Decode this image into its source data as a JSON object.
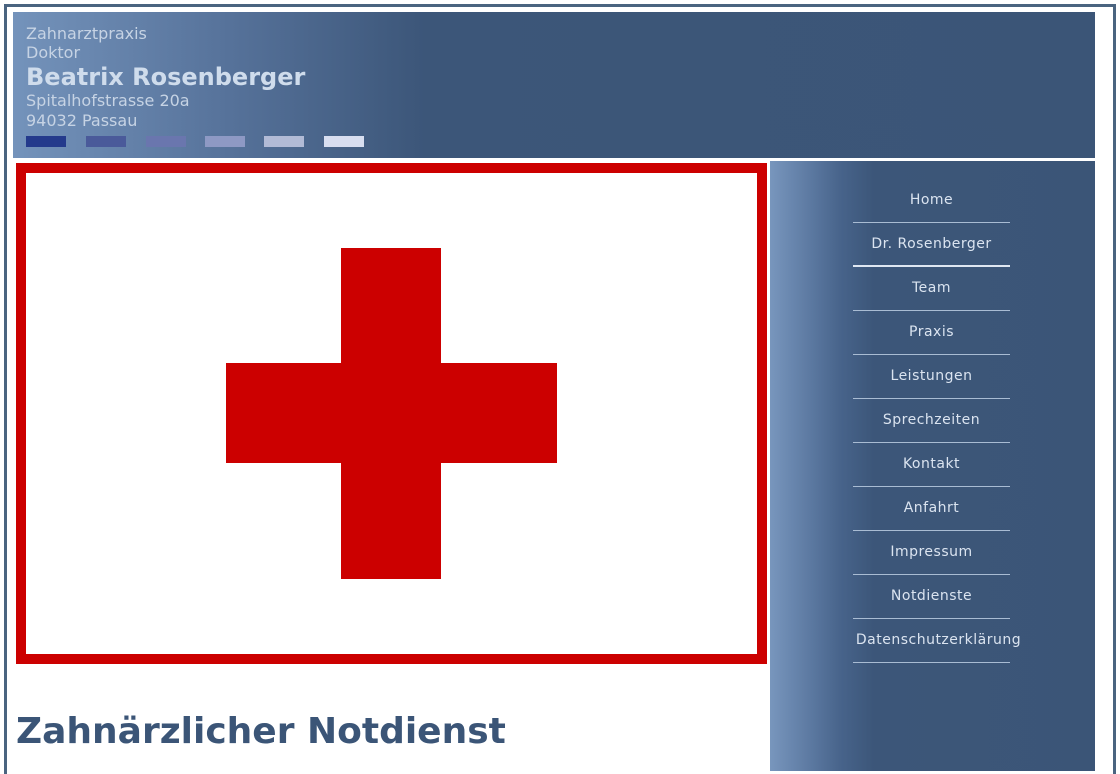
{
  "header": {
    "line1": "Zahnarztpraxis",
    "line2": "Doktor",
    "name": "Beatrix Rosenberger",
    "street": "Spitalhofstrasse 20a",
    "city": "94032 Passau",
    "swatches": [
      "#243a8c",
      "#4a5a9a",
      "#6a76ae",
      "#8e99c4",
      "#b2bbd6",
      "#d8def0"
    ]
  },
  "image": {
    "icon": "red-cross-icon",
    "color": "#cc0000"
  },
  "nav": {
    "items": [
      {
        "label": "Home"
      },
      {
        "label": "Dr. Rosenberger",
        "active": true
      },
      {
        "label": "Team"
      },
      {
        "label": "Praxis"
      },
      {
        "label": "Leistungen"
      },
      {
        "label": "Sprechzeiten"
      },
      {
        "label": "Kontakt"
      },
      {
        "label": "Anfahrt"
      },
      {
        "label": "Impressum"
      },
      {
        "label": "Notdienste"
      },
      {
        "label": "Datenschutzerklärung"
      }
    ]
  },
  "main": {
    "heading": "Zahnärzlicher Notdienst"
  },
  "colors": {
    "accent": "#3b5577",
    "cross": "#cc0000"
  }
}
